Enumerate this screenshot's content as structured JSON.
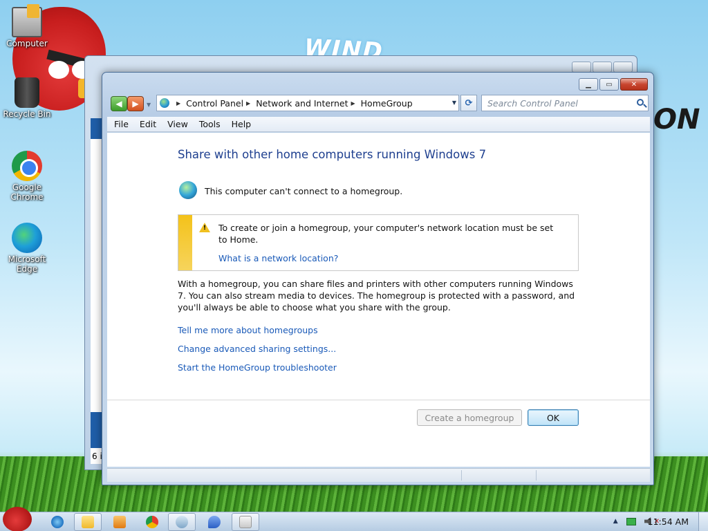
{
  "desktop": {
    "icons": [
      {
        "label": "Computer"
      },
      {
        "label": "Recycle Bin"
      },
      {
        "label": "Google Chrome"
      },
      {
        "label": "Microsoft Edge"
      }
    ]
  },
  "background_window": {
    "status_text": "6 i"
  },
  "window": {
    "breadcrumb": [
      "Control Panel",
      "Network and Internet",
      "HomeGroup"
    ],
    "search_placeholder": "Search Control Panel",
    "menu": [
      "File",
      "Edit",
      "View",
      "Tools",
      "Help"
    ],
    "heading": "Share with other home computers running Windows 7",
    "status_text": "This computer can't connect to a homegroup.",
    "warning": {
      "text": "To create or join a homegroup, your computer's network location must be set to Home.",
      "link": "What is a network location?"
    },
    "body_text": "With a homegroup, you can share files and printers with other computers running Windows 7. You can also stream media to devices. The homegroup is protected with a password, and you'll always be able to choose what you share with the group.",
    "links": [
      "Tell me more about homegroups",
      "Change advanced sharing settings...",
      "Start the HomeGroup troubleshooter"
    ],
    "buttons": {
      "create": "Create a homegroup",
      "ok": "OK"
    }
  },
  "taskbar": {
    "clock": "11:54 AM"
  },
  "colors": {
    "heading": "#1e3f8f",
    "link": "#1a5ab8",
    "warning_stripe": "#f4c21a",
    "close_button": "#c8452f"
  }
}
